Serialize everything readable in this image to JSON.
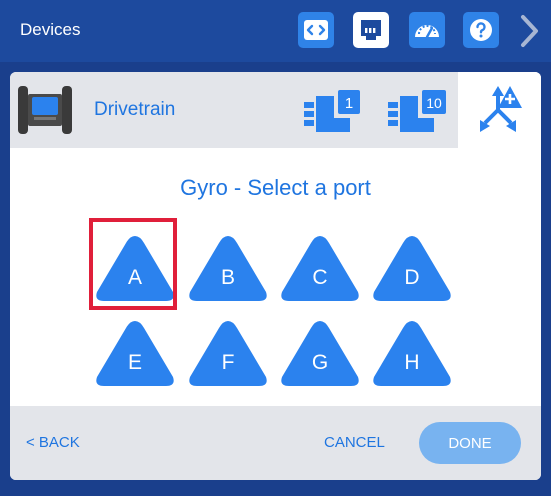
{
  "topbar": {
    "title": "Devices",
    "buttons": [
      {
        "name": "code-icon",
        "active": false
      },
      {
        "name": "port-icon",
        "active": true
      },
      {
        "name": "dashboard-icon",
        "active": false
      },
      {
        "name": "help-icon",
        "active": false
      }
    ]
  },
  "device": {
    "name": "Drivetrain",
    "sensor_badge_1": "1",
    "sensor_badge_2": "10"
  },
  "prompt": "Gyro - Select a port",
  "ports": [
    "A",
    "B",
    "C",
    "D",
    "E",
    "F",
    "G",
    "H"
  ],
  "selected_port": "A",
  "footer": {
    "back_label": "< BACK",
    "cancel_label": "CANCEL",
    "done_label": "DONE"
  },
  "colors": {
    "accent": "#1f75e0",
    "port_fill": "#2b82ee",
    "selection": "#e01f3a",
    "done_disabled": "#78b3f0"
  }
}
